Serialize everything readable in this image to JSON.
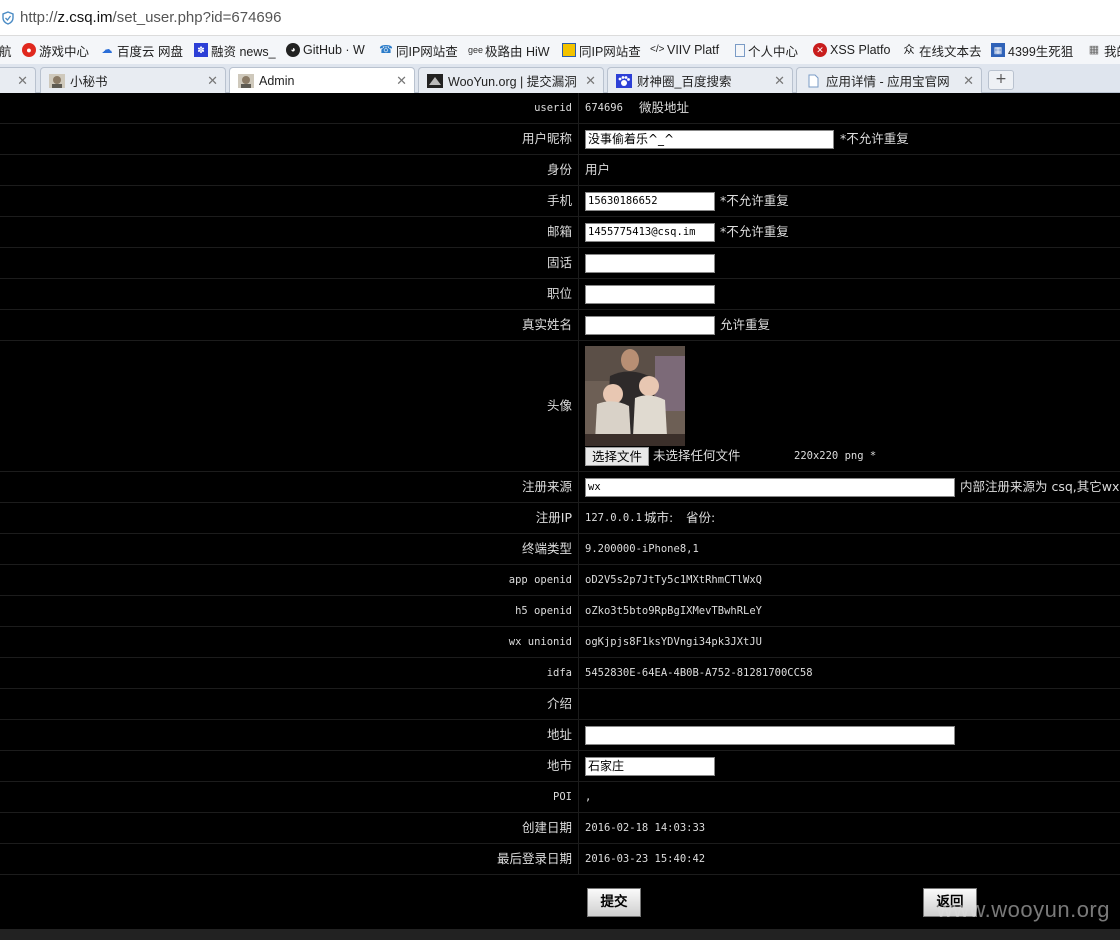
{
  "browser": {
    "url_prefix": "http://",
    "url_host": "z.csq.im",
    "url_path": "/set_user.php?id=674696",
    "bookmarks": [
      {
        "label": "航",
        "icon": "none"
      },
      {
        "label": "游戏中心",
        "icon": "game-icon"
      },
      {
        "label": "百度云 网盘",
        "icon": "cloud-icon"
      },
      {
        "label": "融资 news_",
        "icon": "paw-icon"
      },
      {
        "label": "GitHub · W",
        "icon": "github-icon"
      },
      {
        "label": "同IP网站查",
        "icon": "phone-icon"
      },
      {
        "label": "极路由 HiW",
        "icon": "router-icon"
      },
      {
        "label": "同IP网站查",
        "icon": "site-icon"
      },
      {
        "label": "VIIV Platf",
        "icon": "code-icon"
      },
      {
        "label": "个人中心",
        "icon": "page-icon"
      },
      {
        "label": "XSS Platfo",
        "icon": "xss-icon"
      },
      {
        "label": "在线文本去",
        "icon": "text-icon"
      },
      {
        "label": "4399生死狙",
        "icon": "grid-icon"
      },
      {
        "label": "我的",
        "icon": "grid-icon"
      }
    ],
    "tabs": [
      {
        "label": "",
        "active": false
      },
      {
        "label": "小秘书",
        "active": false
      },
      {
        "label": "Admin",
        "active": true
      },
      {
        "label": "WooYun.org | 提交漏洞",
        "active": false
      },
      {
        "label": "财神圈_百度搜索",
        "active": false
      },
      {
        "label": "应用详情 - 应用宝官网",
        "active": false
      }
    ],
    "new_tab": "+"
  },
  "form": {
    "userid": {
      "label": "userid",
      "value": "674696",
      "extra": "微股地址"
    },
    "nickname": {
      "label": "用户昵称",
      "value": "没事偷着乐^_^",
      "note": "*不允许重复"
    },
    "identity": {
      "label": "身份",
      "value": "用户"
    },
    "phone": {
      "label": "手机",
      "value": "15630186652",
      "note": "*不允许重复"
    },
    "email": {
      "label": "邮箱",
      "value": "1455775413@csq.im",
      "note": "*不允许重复"
    },
    "landline": {
      "label": "固话",
      "value": ""
    },
    "position": {
      "label": "职位",
      "value": ""
    },
    "realname": {
      "label": "真实姓名",
      "value": "",
      "note": "允许重复"
    },
    "avatar": {
      "label": "头像",
      "file_button": "选择文件",
      "file_status": "未选择任何文件",
      "hint": "220x220 png *"
    },
    "source": {
      "label": "注册来源",
      "value": "wx",
      "note": "内部注册来源为 csq,其它wx,c"
    },
    "reg_ip": {
      "label": "注册IP",
      "value": "127.0.0.1",
      "city_label": "城市:",
      "province_label": "省份:"
    },
    "device": {
      "label": "终端类型",
      "value": "9.200000-iPhone8,1"
    },
    "app_openid": {
      "label": "app openid",
      "value": "oD2V5s2p7JtTy5c1MXtRhmCTlWxQ"
    },
    "h5_openid": {
      "label": "h5 openid",
      "value": "oZko3t5bto9RpBgIXMevTBwhRLeY"
    },
    "wx_unionid": {
      "label": "wx unionid",
      "value": "ogKjpjs8F1ksYDVngi34pk3JXtJU"
    },
    "idfa": {
      "label": "idfa",
      "value": "5452830E-64EA-4B0B-A752-81281700CC58"
    },
    "intro": {
      "label": "介绍",
      "value": ""
    },
    "address": {
      "label": "地址",
      "value": ""
    },
    "city": {
      "label": "地市",
      "value": "石家庄"
    },
    "poi": {
      "label": "POI",
      "value": ","
    },
    "created": {
      "label": "创建日期",
      "value": "2016-02-18 14:03:33"
    },
    "last_login": {
      "label": "最后登录日期",
      "value": "2016-03-23 15:40:42"
    }
  },
  "actions": {
    "submit": "提交",
    "back": "返回"
  },
  "watermark": "www.wooyun.org"
}
